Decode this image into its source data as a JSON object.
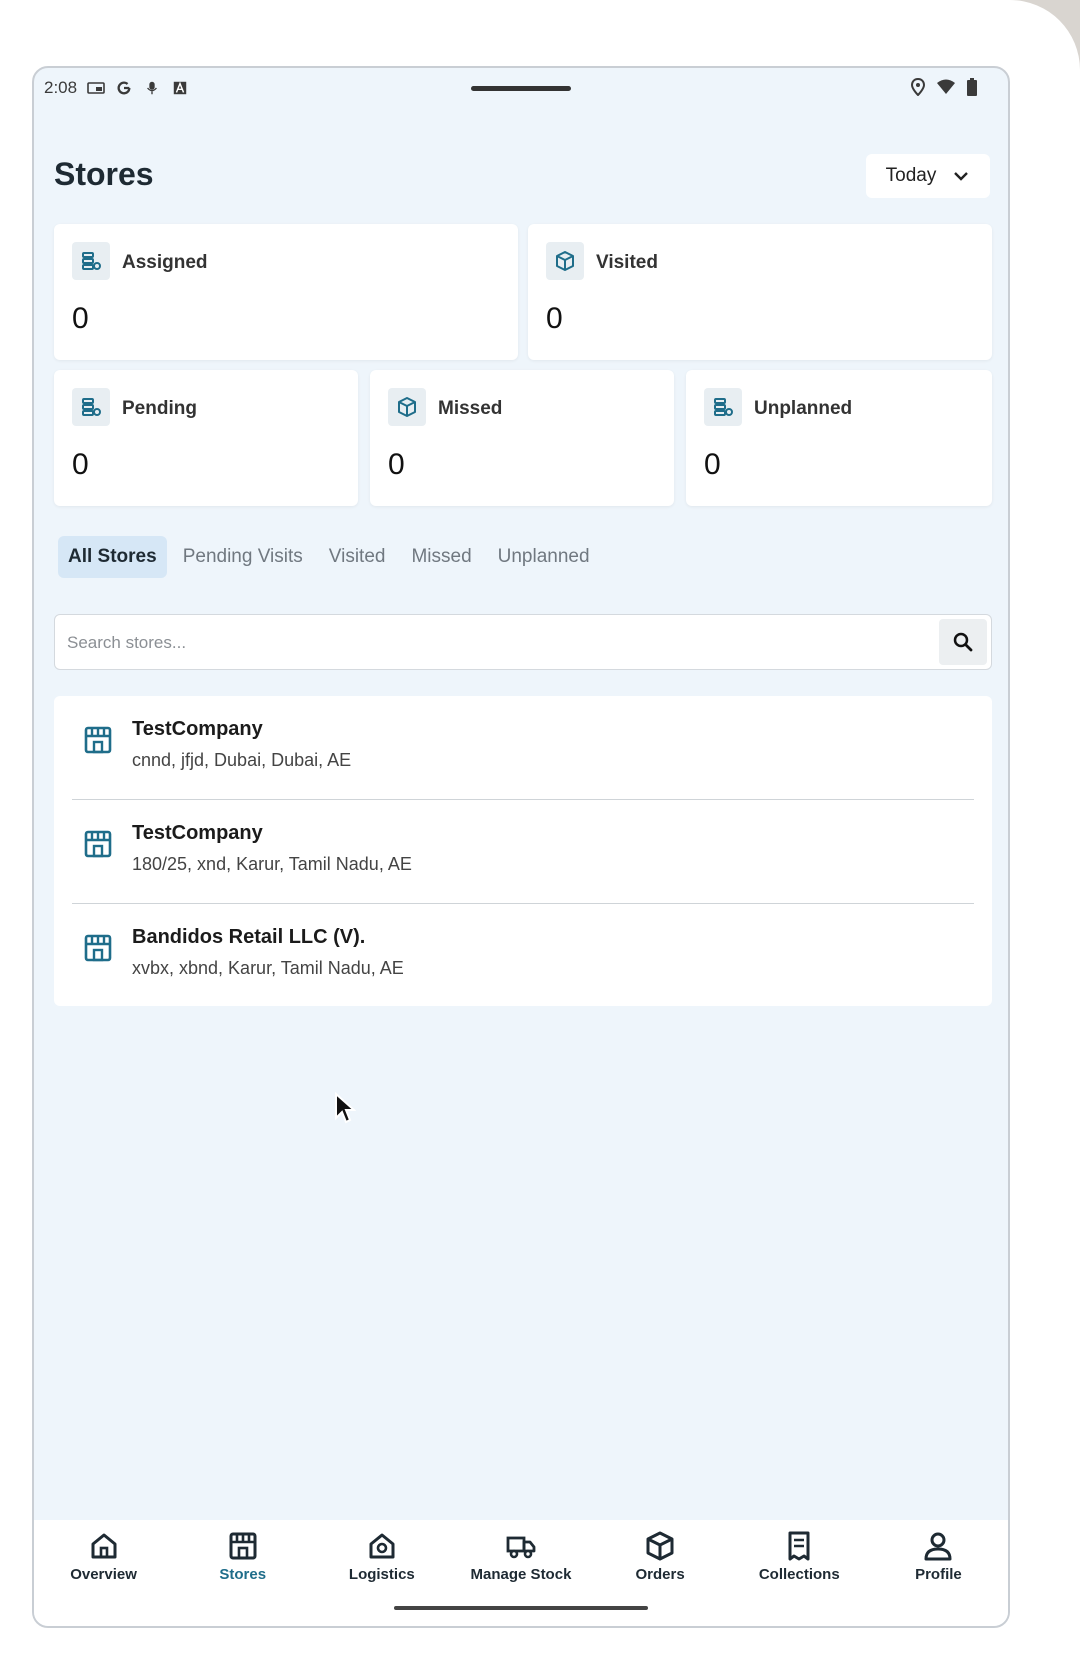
{
  "status_bar": {
    "time": "2:08"
  },
  "header": {
    "title": "Stores",
    "date_filter": "Today"
  },
  "summary": [
    {
      "label": "Assigned",
      "value": "0",
      "icon": "store-stack-icon"
    },
    {
      "label": "Visited",
      "value": "0",
      "icon": "box-icon"
    },
    {
      "label": "Pending",
      "value": "0",
      "icon": "store-stack-icon"
    },
    {
      "label": "Missed",
      "value": "0",
      "icon": "box-icon"
    },
    {
      "label": "Unplanned",
      "value": "0",
      "icon": "store-stack-icon"
    }
  ],
  "tabs": [
    "All Stores",
    "Pending Visits",
    "Visited",
    "Missed",
    "Unplanned"
  ],
  "active_tab": "All Stores",
  "search": {
    "placeholder": "Search stores..."
  },
  "stores": [
    {
      "name": "TestCompany",
      "address": "cnnd, jfjd, Dubai, Dubai, AE"
    },
    {
      "name": "TestCompany",
      "address": "180/25, xnd, Karur, Tamil Nadu, AE"
    },
    {
      "name": "Bandidos Retail LLC (V).",
      "address": "xvbx, xbnd, Karur, Tamil Nadu, AE"
    }
  ],
  "bottom_nav": [
    {
      "label": "Overview",
      "icon": "home-icon"
    },
    {
      "label": "Stores",
      "icon": "storefront-icon"
    },
    {
      "label": "Logistics",
      "icon": "logistics-icon"
    },
    {
      "label": "Manage Stock",
      "icon": "truck-icon"
    },
    {
      "label": "Orders",
      "icon": "package-icon"
    },
    {
      "label": "Collections",
      "icon": "receipt-icon"
    },
    {
      "label": "Profile",
      "icon": "person-icon"
    }
  ],
  "active_nav": "Stores",
  "colors": {
    "accent": "#1f6d8a",
    "background": "#eef5fb",
    "tab_active_bg": "#d6e7f6"
  }
}
